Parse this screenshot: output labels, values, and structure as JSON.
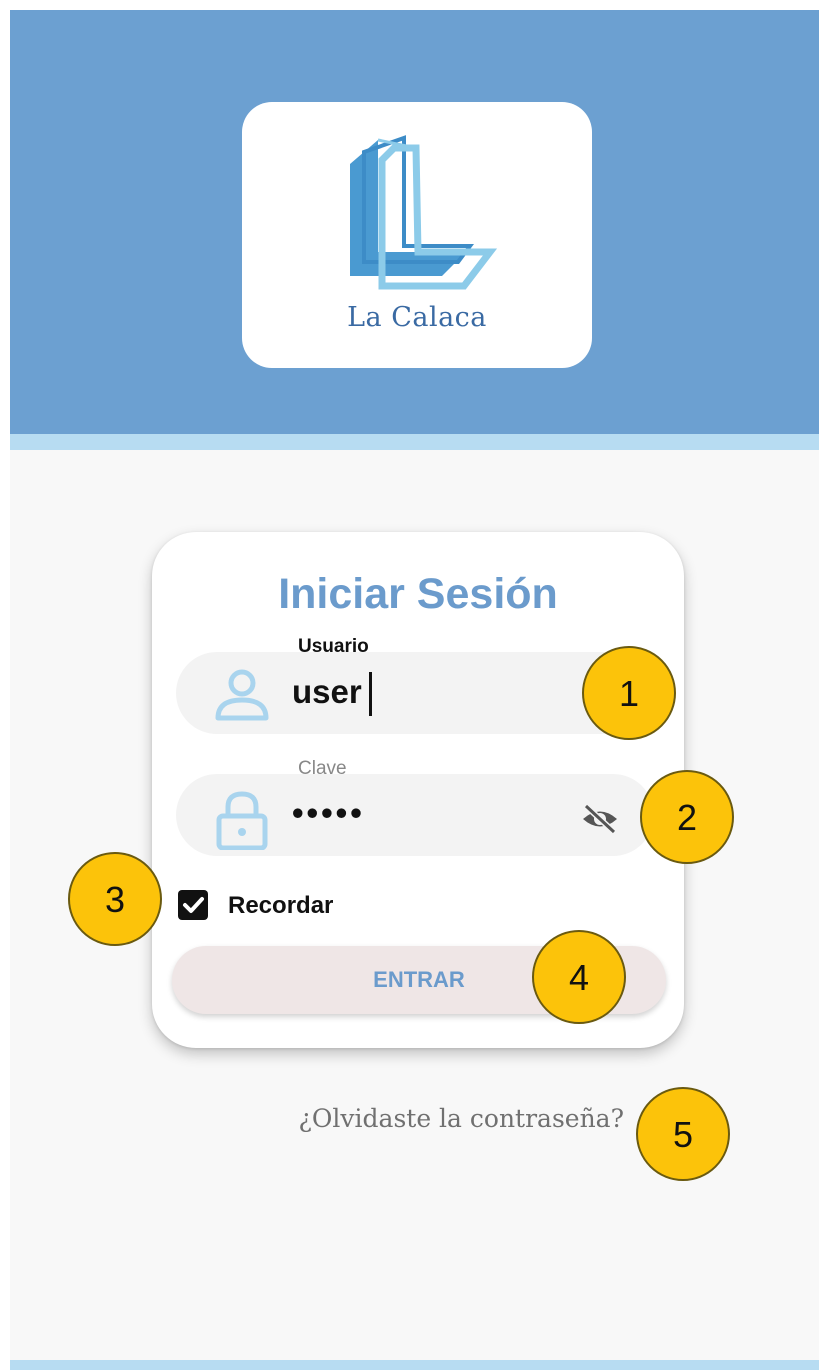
{
  "logo": {
    "text": "La Calaca"
  },
  "login": {
    "title": "Iniciar Sesión",
    "username_label": "Usuario",
    "username_value": "user",
    "password_label": "Clave",
    "password_value": "•••••",
    "remember_label": "Recordar",
    "remember_checked": true,
    "submit_label": "ENTRAR"
  },
  "forgot_password": "¿Olvidaste la contraseña?",
  "callouts": [
    "1",
    "2",
    "3",
    "4",
    "5"
  ],
  "icons": {
    "username": "user-icon",
    "password": "lock-icon",
    "visibility": "eye-off-icon",
    "checkbox": "check-icon"
  },
  "colors": {
    "header_bg": "#6ca0d1",
    "header_band": "#b7dcf2",
    "accent": "#6b9bcc",
    "callout": "#fcc30a",
    "button_bg": "#efe6e6",
    "page_bg": "#f8f8f8"
  }
}
